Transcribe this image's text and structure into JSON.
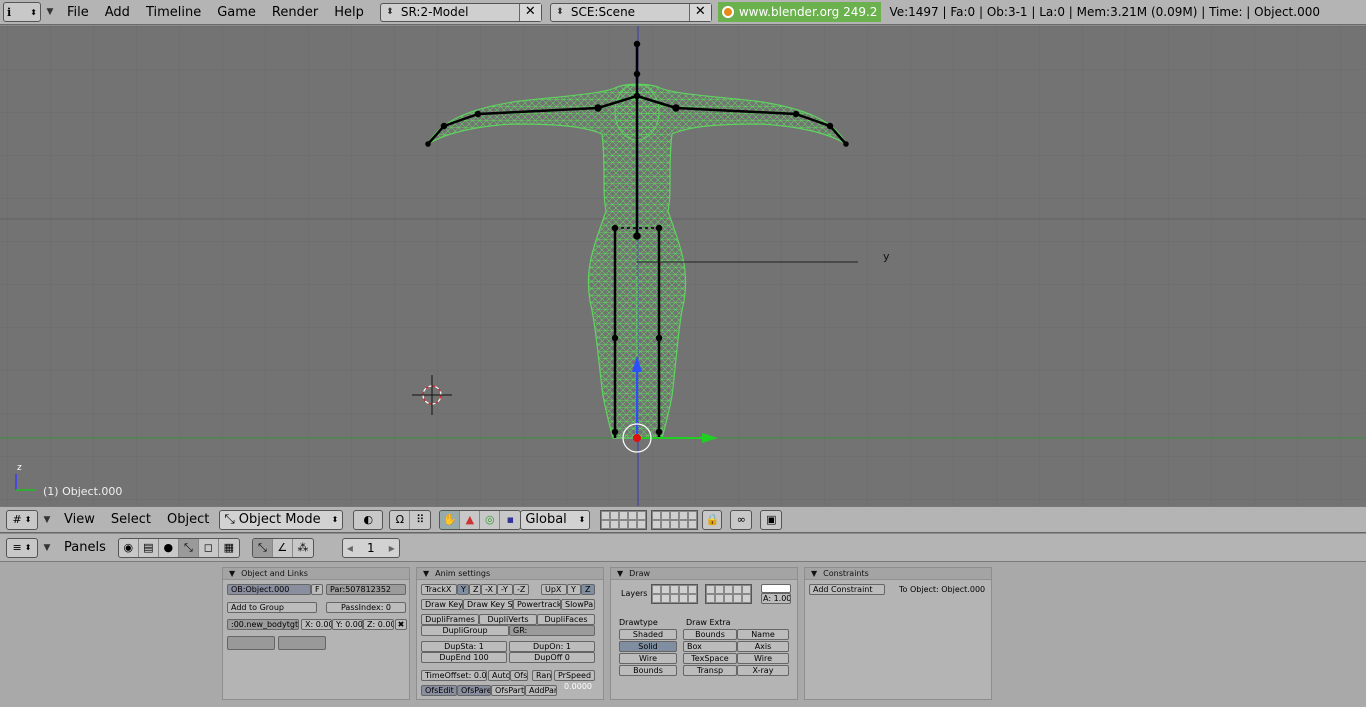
{
  "top": {
    "menus": [
      "File",
      "Add",
      "Timeline",
      "Game",
      "Render",
      "Help"
    ],
    "screen_field": "SR:2-Model",
    "scene_field": "SCE:Scene",
    "blender_link": "www.blender.org 249.2",
    "stats": "Ve:1497 | Fa:0 | Ob:3-1 | La:0  | Mem:3.21M (0.09M)  | Time: | Object.000"
  },
  "viewport": {
    "object_label": "(1) Object.000",
    "axis_y_label": "y",
    "axis_z_label": "z"
  },
  "view3d_header": {
    "menus": [
      "View",
      "Select",
      "Object"
    ],
    "mode": "Object Mode",
    "orientation": "Global"
  },
  "buttons_header": {
    "panels_label": "Panels",
    "frame": "1"
  },
  "panels": {
    "object_links": {
      "title": "Object and Links",
      "ob_field": "OB:Object.000",
      "f_button": "F",
      "par_field": "Par:507812352",
      "add_to_group": "Add to Group",
      "pass_index": "PassIndex: 0",
      "vgroup_field": ":00.new_bodytgt",
      "x": "X: 0.00",
      "y": "Y: 0.00",
      "z": "Z: 0.00"
    },
    "anim": {
      "title": "Anim settings",
      "track_label": "TrackX",
      "track_axes": [
        "Y",
        "Z",
        "-X",
        "-Y",
        "-Z"
      ],
      "up_label": "UpX",
      "up_axes": [
        "Y",
        "Z"
      ],
      "row2": [
        "Draw Key",
        "Draw Key S",
        "Powertrack",
        "SlowPa"
      ],
      "row3": [
        "DupliFrames",
        "DupliVerts",
        "DupliFaces"
      ],
      "dupli_group": "DupliGroup",
      "gr_field": "GR:",
      "dup_sta": "DupSta: 1",
      "dup_on": "DupOn: 1",
      "dup_end": "DupEnd 100",
      "dup_off": "DupOff 0",
      "time_offset": "TimeOffset: 0.00",
      "row_time": [
        "Auto",
        "Ofs",
        "Ran",
        "PrSpeed"
      ],
      "row_ofs": [
        "OfsEdit",
        "OfsPare",
        "OfsPartl",
        "AddPar"
      ],
      "speed_val": "0.0000"
    },
    "draw": {
      "title": "Draw",
      "layers_label": "Layers",
      "alpha": "A: 1.00",
      "drawtype_label": "Drawtype",
      "draw_extra_label": "Draw Extra",
      "drawtypes": [
        "Shaded",
        "Solid",
        "Wire",
        "Bounds"
      ],
      "extra_left": [
        "Bounds",
        "Box",
        "TexSpace",
        "Transp"
      ],
      "extra_right": [
        "Name",
        "Axis",
        "Wire",
        "X-ray"
      ]
    },
    "constraints": {
      "title": "Constraints",
      "add_constraint": "Add Constraint",
      "to_object": "To Object: Object.000"
    }
  },
  "colors": {
    "viewport_bg": "#737373",
    "grid": "#6a6a6a",
    "mesh_wire": "#5fd35f",
    "armature": "#000000",
    "header": "#b4b4b4",
    "link_green": "#6bb24f"
  }
}
